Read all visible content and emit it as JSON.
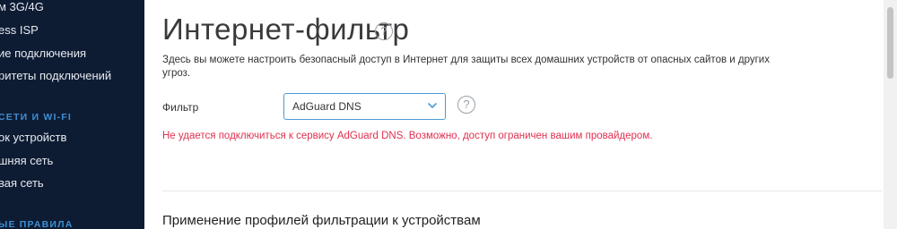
{
  "sidebar": {
    "items": [
      {
        "label": "м 3G/4G"
      },
      {
        "label": "ess ISP"
      },
      {
        "label": "ие подключения"
      },
      {
        "label": "ритеты подключений"
      }
    ],
    "section_network": "СЕТИ И WI-FI",
    "network_items": [
      {
        "label": "ок устройств"
      },
      {
        "label": "шняя сеть"
      },
      {
        "label": "вая сеть"
      }
    ],
    "section_rules": "ЫЕ ПРАВИЛА"
  },
  "main": {
    "title": "Интернет-фильтр",
    "description": "Здесь вы можете настроить безопасный доступ в Интернет для защиты всех домашних устройств от опасных сайтов и других угроз.",
    "filter_label": "Фильтр",
    "filter_value": "AdGuard DNS",
    "error_message": "Не удается подключиться к сервису AdGuard DNS. Возможно, доступ ограничен вашим провайдером.",
    "section_heading": "Применение профилей фильтрации к устройствам",
    "help_glyph": "?"
  },
  "colors": {
    "sidebar_bg": "#0e1c33",
    "sidebar_section": "#3d8fd4",
    "select_border": "#4a9bd8",
    "error": "#e0304e"
  },
  "icons": [
    "help-circle-icon",
    "chevron-down-icon"
  ]
}
